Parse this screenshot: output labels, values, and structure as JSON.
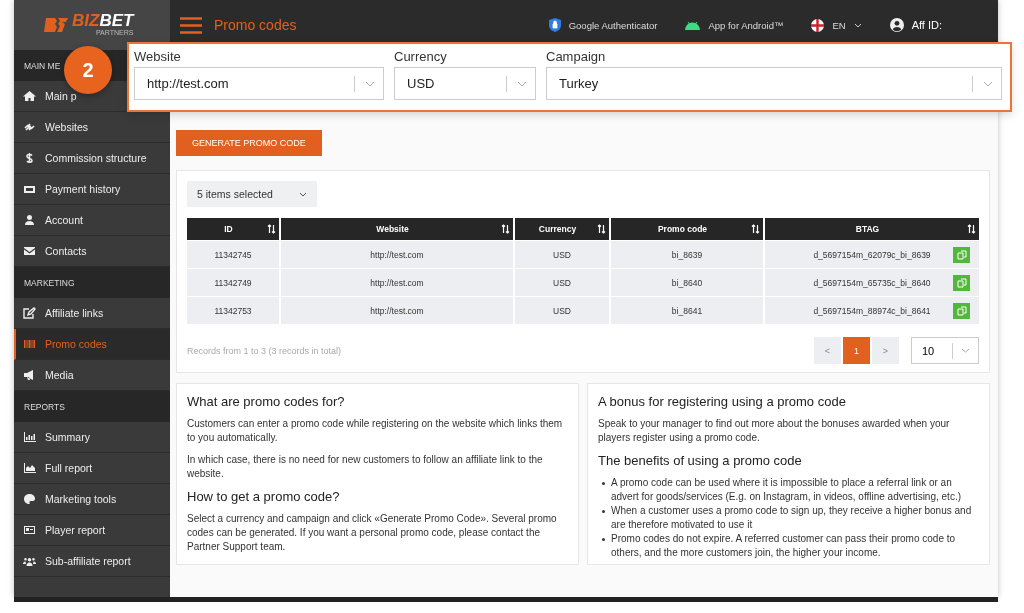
{
  "logo": {
    "part1": "BIZ",
    "part2": "BET",
    "tagline": "PARTNERS"
  },
  "header": {
    "title": "Promo codes",
    "links": [
      {
        "kind": "auth",
        "label": "Google Authenticator"
      },
      {
        "kind": "android",
        "label": "App for Android™"
      },
      {
        "kind": "lang",
        "label": "EN"
      },
      {
        "kind": "user",
        "label": "Aff ID:"
      }
    ]
  },
  "sidebar": {
    "sections": [
      {
        "title": "MAIN ME",
        "items": [
          {
            "label": "Main p",
            "selected": false
          },
          {
            "label": "Websites",
            "selected": false
          },
          {
            "label": "Commission structure",
            "selected": false
          },
          {
            "label": "Payment history",
            "selected": false
          },
          {
            "label": "Account",
            "selected": false
          },
          {
            "label": "Contacts",
            "selected": false
          }
        ]
      },
      {
        "title": "MARKETING",
        "items": [
          {
            "label": "Affiliate links",
            "selected": false
          },
          {
            "label": "Promo codes",
            "selected": true
          },
          {
            "label": "Media",
            "selected": false
          }
        ]
      },
      {
        "title": "REPORTS",
        "items": [
          {
            "label": "Summary",
            "selected": false
          },
          {
            "label": "Full report",
            "selected": false
          },
          {
            "label": "Marketing tools",
            "selected": false
          },
          {
            "label": "Player report",
            "selected": false
          },
          {
            "label": "Sub-affiliate report",
            "selected": false
          }
        ]
      }
    ]
  },
  "callout": {
    "step": "2",
    "filters": [
      {
        "label": "Website",
        "value": "http://test.com"
      },
      {
        "label": "Currency",
        "value": "USD"
      },
      {
        "label": "Campaign",
        "value": "Turkey"
      }
    ]
  },
  "generate_button": "GENERATE PROMO CODE",
  "columns_select": "5 items selected",
  "table": {
    "columns": [
      "ID",
      "Website",
      "Currency",
      "Promo code",
      "BTAG"
    ],
    "rows": [
      [
        "11342745",
        "http://test.com",
        "USD",
        "bi_8639",
        "d_5697154m_62079c_bi_8639"
      ],
      [
        "11342749",
        "http://test.com",
        "USD",
        "bi_8640",
        "d_5697154m_65735c_bi_8640"
      ],
      [
        "11342753",
        "http://test.com",
        "USD",
        "bi_8641",
        "d_5697154m_88974c_bi_8641"
      ]
    ]
  },
  "records_info": "Records from 1 to 3 (3 records in total)",
  "pager": {
    "prev": "<",
    "pages": [
      {
        "label": "1",
        "selected": true
      }
    ],
    "next": ">",
    "page_size": "10"
  },
  "info_left": {
    "heading1": "What are promo codes for?",
    "paragraphs1": [
      "Customers can enter a promo code while registering on the website which links them to you automatically.",
      "In which case, there is no need for new customers to follow an affiliate link to the website."
    ],
    "heading2": "How to get a promo code?",
    "paragraphs2": [
      "Select a currency and campaign and click «Generate Promo Code». Several promo codes can be generated. If you want a personal promo code, please contact the Partner Support team."
    ]
  },
  "info_right": {
    "heading1": "A bonus for registering using a promo code",
    "paragraphs1": [
      "Speak to your manager to find out more about the bonuses awarded when your players register using a promo code."
    ],
    "heading2": "The benefits of using a promo code",
    "bullets": [
      "A promo code can be used where it is impossible to place a referral link or an advert for goods/services (E.g. on Instagram, in videos, offline advertising, etc.)",
      "When a customer uses a promo code to sign up, they receive a higher bonus and are therefore motivated to use it",
      "Promo codes do not expire. A referred customer can pass their promo code to others, and the more customers join, the higher your income."
    ]
  }
}
